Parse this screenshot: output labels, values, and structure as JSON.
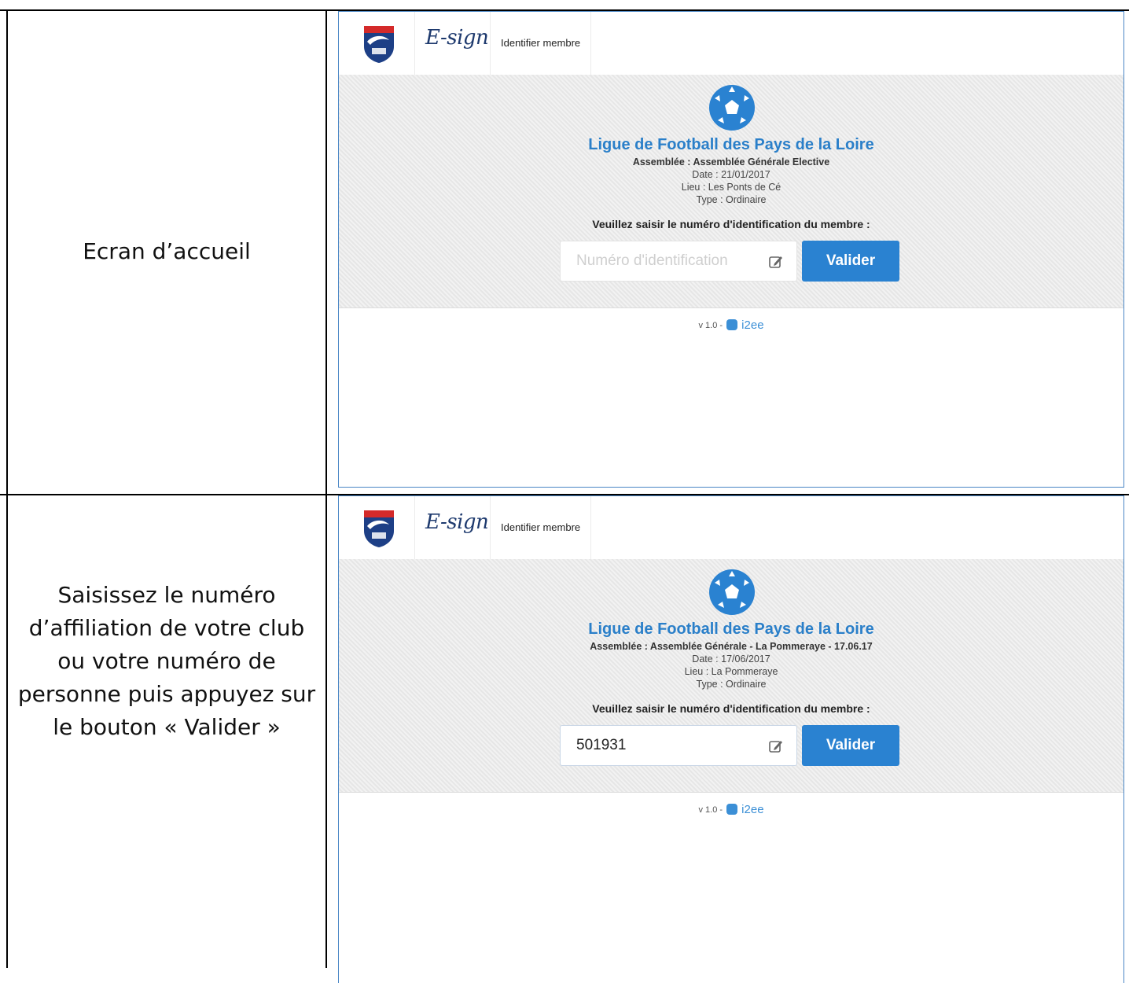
{
  "rows": [
    {
      "description": "Ecran d’accueil",
      "app": {
        "brand": "E-sign",
        "nav_item": "Identifier membre",
        "org_title": "Ligue de Football des Pays de la Loire",
        "assembly": "Assemblée : Assemblée Générale Elective",
        "date": "Date : 21/01/2017",
        "place": "Lieu : Les Ponts de Cé",
        "type": "Type : Ordinaire",
        "prompt": "Veuillez saisir le numéro d'identification du membre :",
        "input_placeholder": "Numéro d'identification",
        "input_value": "",
        "submit_label": "Valider",
        "version": "v 1.0 -",
        "vendor": "i2ee"
      }
    },
    {
      "description": "Saisissez le numéro\nd’affiliation de votre club\nou votre numéro de\npersonne puis appuyez sur\nle bouton « Valider »",
      "app": {
        "brand": "E-sign",
        "nav_item": "Identifier membre",
        "org_title": "Ligue de Football des Pays de la Loire",
        "assembly": "Assemblée : Assemblée Générale - La Pommeraye - 17.06.17",
        "date": "Date : 17/06/2017",
        "place": "Lieu : La Pommeraye",
        "type": "Type : Ordinaire",
        "prompt": "Veuillez saisir le numéro d'identification du membre :",
        "input_placeholder": "Numéro d'identification",
        "input_value": "501931",
        "submit_label": "Valider",
        "version": "v 1.0 -",
        "vendor": "i2ee"
      }
    }
  ],
  "colors": {
    "accent": "#2a82d1",
    "title_blue": "#2a7fc9",
    "frame_border": "#4a86c5"
  },
  "icons": [
    "club-shield-logo",
    "football-icon",
    "edit-icon",
    "i2ee-logo-icon"
  ]
}
